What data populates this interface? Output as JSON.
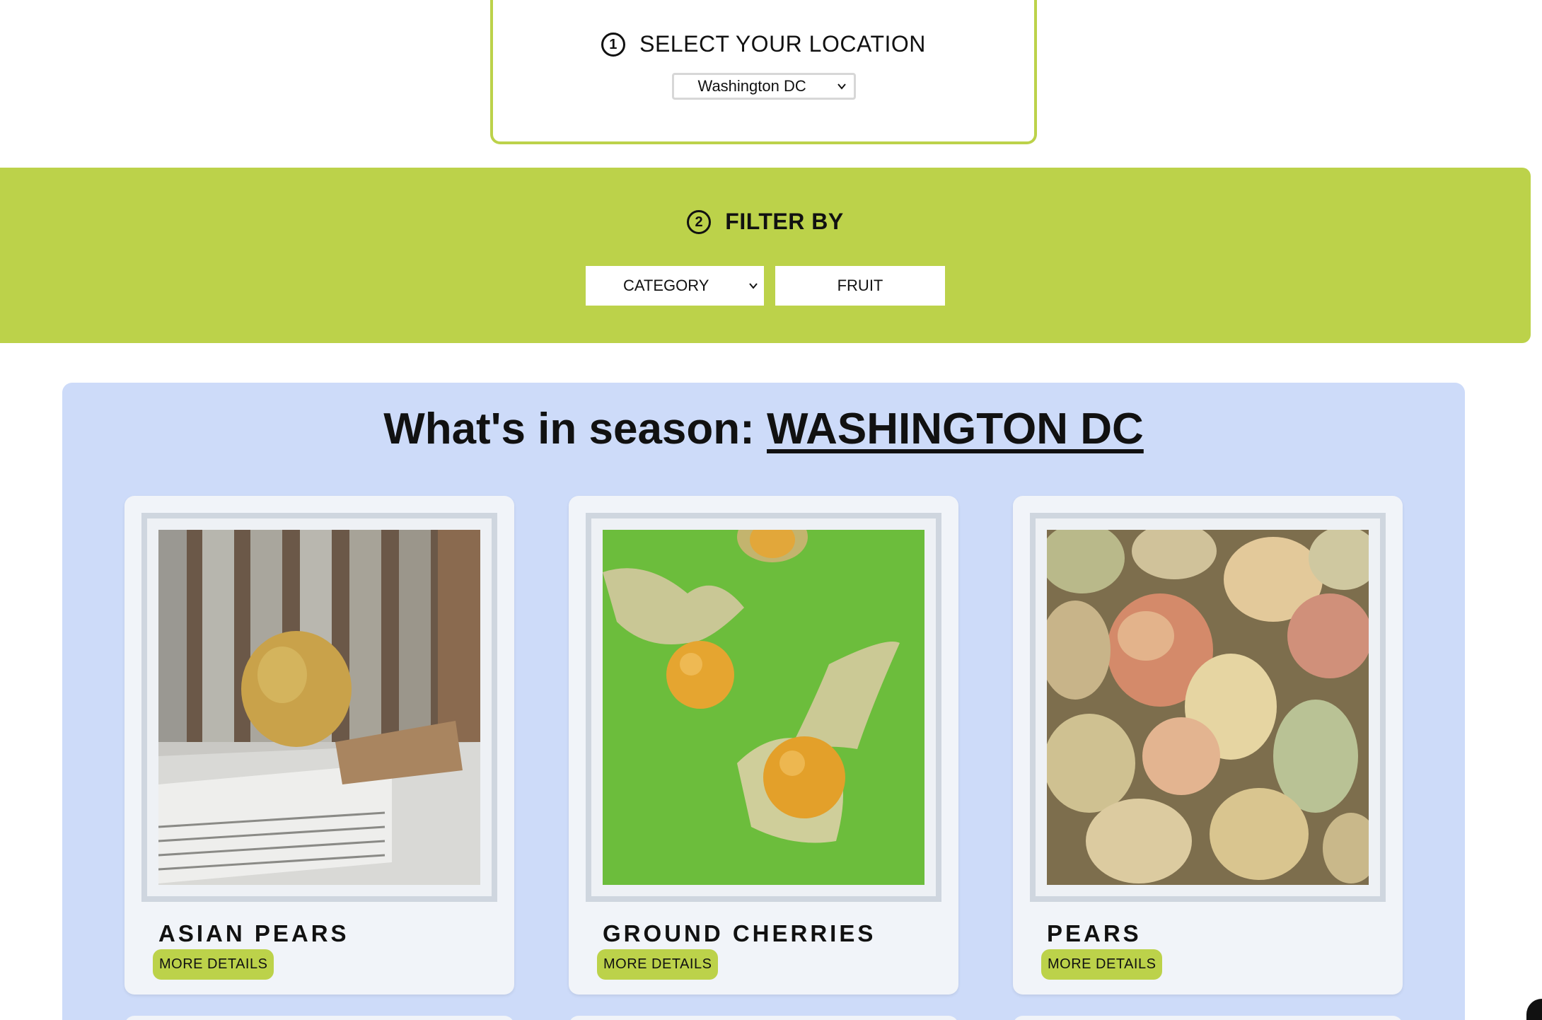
{
  "location_step": {
    "number": "1",
    "title": "SELECT YOUR LOCATION",
    "selected": "Washington DC"
  },
  "filter_step": {
    "number": "2",
    "title": "FILTER BY",
    "category_label": "CATEGORY",
    "value": "FRUIT"
  },
  "season": {
    "prefix": "What's in season: ",
    "location": "WASHINGTON DC",
    "cards": [
      {
        "name": "ASIAN PEARS",
        "button": "MORE DETAILS"
      },
      {
        "name": "GROUND CHERRIES",
        "button": "MORE DETAILS"
      },
      {
        "name": "PEARS",
        "button": "MORE DETAILS"
      }
    ]
  },
  "colors": {
    "accent_green": "#bcd24a",
    "panel_blue": "#cddbf9",
    "card_bg": "#f1f4f9"
  }
}
